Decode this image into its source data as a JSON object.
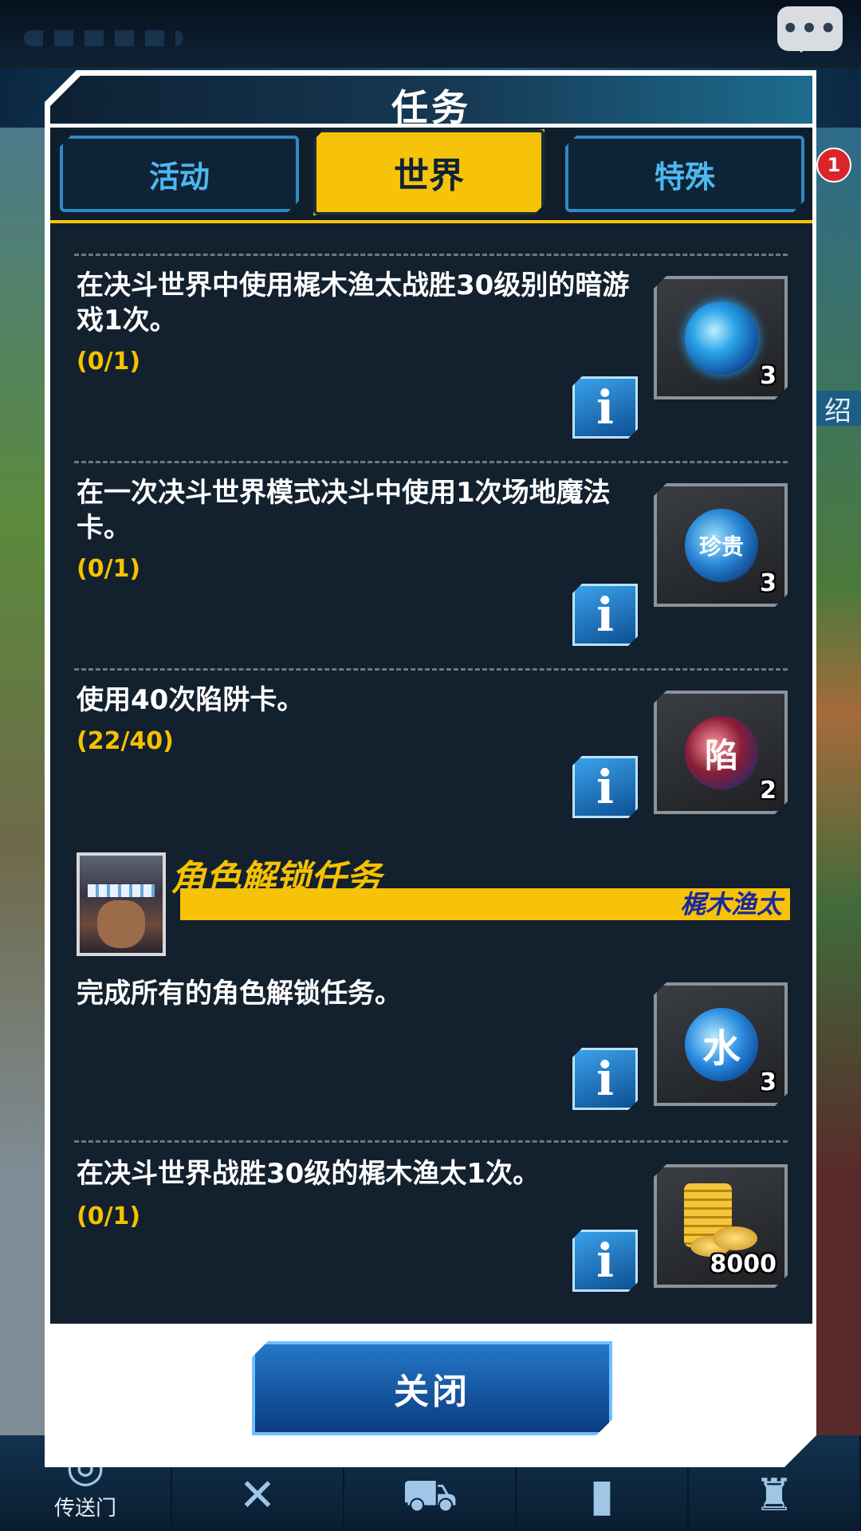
{
  "background": {
    "chat_icon": "chat-bubble-icon",
    "badge_count": "1",
    "right_label": "绍",
    "bottom_nav": [
      {
        "label": "传送门",
        "icon": "portal-icon"
      },
      {
        "label": "",
        "icon": "crossed-swords-icon"
      },
      {
        "label": "",
        "icon": "cart-icon"
      },
      {
        "label": "",
        "icon": "cards-icon"
      },
      {
        "label": "",
        "icon": "armor-icon"
      }
    ]
  },
  "modal": {
    "title": "任务",
    "tabs": [
      {
        "label": "活动",
        "active": false
      },
      {
        "label": "世界",
        "active": true
      },
      {
        "label": "特殊",
        "active": false
      }
    ],
    "missions": [
      {
        "desc": "在决斗世界中使用梶木渔太战胜30级别的暗游戏1次。",
        "progress": "(0/1)",
        "reward_icon": "blue-orb-icon",
        "reward_count": "3"
      },
      {
        "desc": "在一次决斗世界模式决斗中使用1次场地魔法卡。",
        "progress": "(0/1)",
        "reward_icon": "rare-orb-icon",
        "reward_label": "珍贵",
        "reward_count": "3"
      },
      {
        "desc": "使用40次陷阱卡。",
        "progress": "(22/40)",
        "reward_icon": "trap-orb-icon",
        "reward_label": "陷",
        "reward_count": "2"
      }
    ],
    "character_section": {
      "title": "角色解锁任务",
      "name": "梶木渔太"
    },
    "unlock_missions": [
      {
        "desc": "完成所有的角色解锁任务。",
        "progress": "",
        "reward_icon": "water-orb-icon",
        "reward_label": "水",
        "reward_count": "3"
      },
      {
        "desc": "在决斗世界战胜30级的梶木渔太1次。",
        "progress": "(0/1)",
        "reward_icon": "gold-coins-icon",
        "reward_count": "8000"
      }
    ],
    "info_label": "i",
    "close_label": "关闭"
  },
  "colors": {
    "accent_yellow": "#f7c308",
    "panel_dark": "#13202e",
    "tab_blue": "#4db8ef",
    "button_blue": "#0b3c80"
  }
}
